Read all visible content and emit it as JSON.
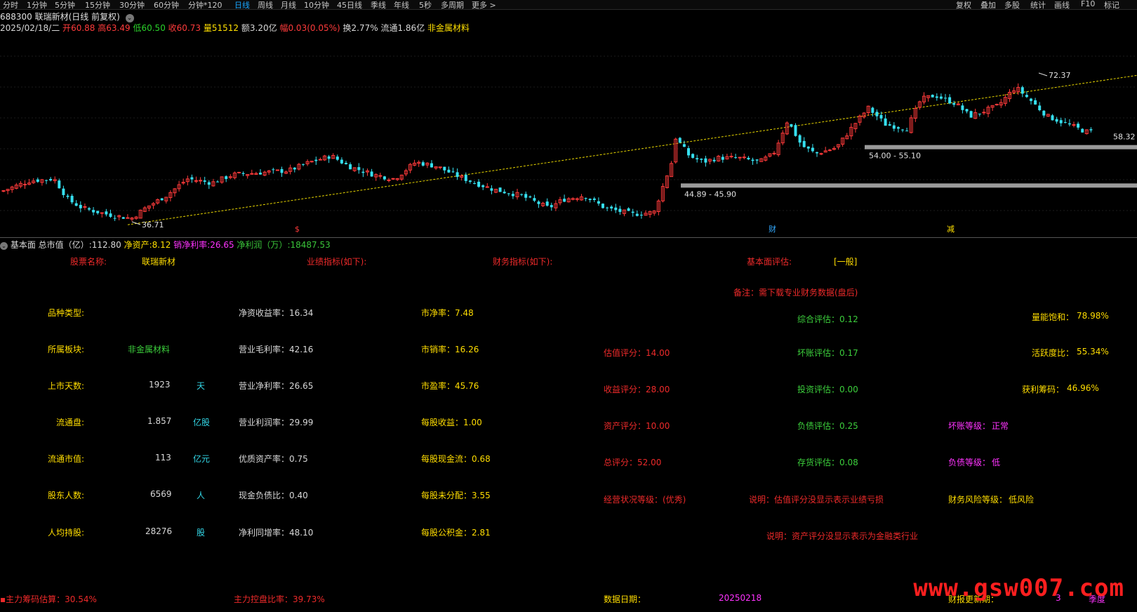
{
  "toolbar": {
    "periods": [
      "分时",
      "1分钟",
      "5分钟",
      "15分钟",
      "30分钟",
      "60分钟",
      "分钟*120",
      "日线",
      "周线",
      "月线",
      "10分钟",
      "45日线",
      "季线",
      "年线",
      "5秒",
      "多周期",
      "更多 >"
    ],
    "active_period": "日线",
    "right_items": [
      "复权",
      "叠加",
      "多股",
      "统计",
      "画线",
      "F10",
      "标记"
    ]
  },
  "stock_header": {
    "title": "688300 联瑞新材(日线 前复权)",
    "date": "2025/02/18/二",
    "open_label": "开",
    "open": "60.88",
    "high_label": "高",
    "high": "63.49",
    "low_label": "低",
    "low": "60.50",
    "close_label": "收",
    "close": "60.73",
    "volume_label": "量",
    "volume": "51512",
    "amount_label": "额",
    "amount": "3.20亿",
    "change_label": "幅",
    "change": "0.03(0.05%)",
    "turnover": "换2.77%",
    "float": "流通1.86亿",
    "sector": "非金属材料"
  },
  "chart_data": {
    "type": "candlestick",
    "annotations": {
      "low_label": "36.71",
      "high_label": "72.37",
      "last_label": "58.32",
      "zone_upper": "54.00 - 55.10",
      "zone_lower": "44.89 - 45.90"
    },
    "markers": [
      "$",
      "财",
      "减"
    ]
  },
  "fund_bar": {
    "name": "基本面",
    "mktcap_label": "总市值（亿）",
    "mktcap": "112.80",
    "netasset_label": "净资产",
    "netasset": "8.12",
    "netmargin_label": "销净利率",
    "netmargin": "26.65",
    "netprofit_label": "净利润（万）",
    "netprofit": "18487.53"
  },
  "panel": {
    "name_label": "股票名称:",
    "name_value": "联瑞新材",
    "perf_label": "业绩指标(如下):",
    "fin_label": "财务指标(如下):",
    "eval_label": "基本面评估:",
    "eval_value": "[一般]",
    "note": "备注：需下载专业财务数据(盘后)",
    "col1": [
      {
        "label": "品种类型:",
        "value": "",
        "unit": ""
      },
      {
        "label": "所属板块:",
        "value": "非金属材料",
        "unit": ""
      },
      {
        "label": "上市天数:",
        "value": "1923",
        "unit": "天"
      },
      {
        "label": "流通盘:",
        "value": "1.857",
        "unit": "亿股"
      },
      {
        "label": "流通市值:",
        "value": "113",
        "unit": "亿元"
      },
      {
        "label": "股东人数:",
        "value": "6569",
        "unit": "人"
      },
      {
        "label": "人均持股:",
        "value": "28276",
        "unit": "股"
      }
    ],
    "col2": [
      "净资收益率：16.34",
      "营业毛利率：42.16",
      "营业净利率：26.65",
      "营业利润率：29.99",
      "优质资产率：0.75",
      "现金负债比：0.40",
      "净利同增率：48.10"
    ],
    "col3": [
      "市净率：7.48",
      "市销率：16.26",
      "市盈率：45.76",
      "每股收益：1.00",
      "每股现金流：0.68",
      "每股未分配：3.55",
      "每股公积金：2.81"
    ],
    "col4": [
      "估值评分：14.00",
      "收益评分：28.00",
      "资产评分：10.00",
      "总评分：52.00",
      "经营状况等级：(优秀)"
    ],
    "col5": [
      "综合评估：0.12",
      "坏账评估：0.17",
      "投资评估：0.00",
      "负债评估：0.25",
      "存货评估：0.08"
    ],
    "col5_note1": "说明：估值评分没显示表示业绩亏损",
    "col5_note2": "说明：资产评分没显示表示为金融类行业",
    "col6": [
      {
        "label": "量能饱和：",
        "value": "78.98%"
      },
      {
        "label": "活跃度比：",
        "value": "55.34%"
      },
      {
        "label": "获利筹码：",
        "value": "46.96%"
      }
    ],
    "col6_more": [
      {
        "label": "坏账等级：",
        "value": "正常"
      },
      {
        "label": "负债等级：",
        "value": "低"
      },
      {
        "label": "财务风险等级：",
        "value": "低风险"
      }
    ]
  },
  "bottom": {
    "chip_label": "主力筹码估算：",
    "chip_value": "30.54%",
    "control_label": "主力控盘比率：",
    "control_value": "39.73%",
    "date_label": "数据日期：",
    "date_value": "20250218",
    "report_label": "财报更新期：",
    "report_value": "3",
    "report_unit": "季度",
    "watermark": "www.gsw007.com"
  }
}
